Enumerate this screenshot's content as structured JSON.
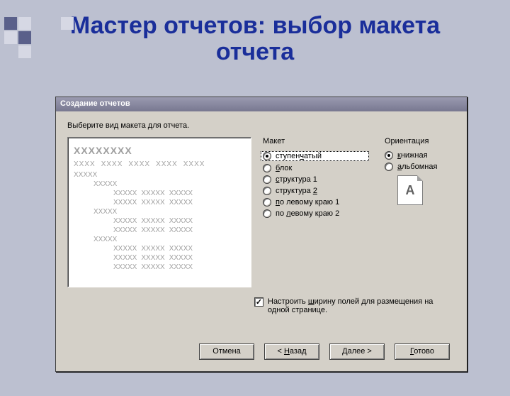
{
  "slide": {
    "title": "Мастер отчетов: выбор макета отчета"
  },
  "dialog": {
    "title": "Создание отчетов",
    "instruction": "Выберите вид макета для отчета.",
    "layout": {
      "group_label": "Макет",
      "options": {
        "stepped": "ступенчатый",
        "block": "блок",
        "outline1": "структура 1",
        "outline2": "структура 2",
        "align_left1": "по левому краю 1",
        "align_left2": "по левому краю 2"
      },
      "underline": {
        "stepped": "ч",
        "block": "б",
        "outline1": "с",
        "outline2": "2",
        "align_left1": "п",
        "align_left2": "л"
      }
    },
    "orientation": {
      "group_label": "Ориентация",
      "options": {
        "portrait": "книжная",
        "landscape": "альбомная"
      },
      "underline": {
        "portrait": "к",
        "landscape": "а"
      },
      "icon_letter": "A"
    },
    "adjust": {
      "label": "Настроить ширину полей для размещения на одной странице.",
      "underline": "ш"
    },
    "buttons": {
      "cancel": "Отмена",
      "back": "< Назад",
      "next": "Далее >",
      "finish": "Готово"
    }
  },
  "preview": {
    "heading": "XXXXXXXX",
    "col": "XXXX",
    "cell": "XXXXX"
  }
}
